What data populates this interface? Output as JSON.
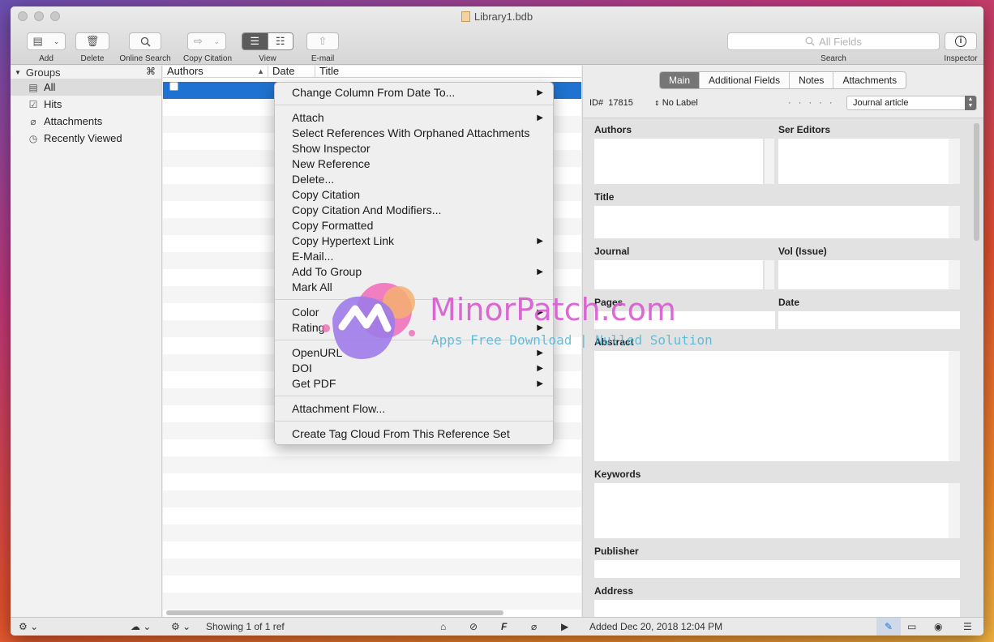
{
  "window": {
    "title": "Library1.bdb"
  },
  "toolbar": {
    "add_label": "Add",
    "delete_label": "Delete",
    "online_search_label": "Online Search",
    "copy_citation_label": "Copy Citation",
    "view_label": "View",
    "email_label": "E-mail",
    "search_placeholder": "All Fields",
    "search_label": "Search",
    "inspector_label": "Inspector"
  },
  "sidebar": {
    "header": "Groups",
    "header_shortcut": "⌘",
    "items": [
      {
        "label": "All",
        "icon": "library-icon",
        "selected": true
      },
      {
        "label": "Hits",
        "icon": "checkbox-icon"
      },
      {
        "label": "Attachments",
        "icon": "paperclip-icon"
      },
      {
        "label": "Recently Viewed",
        "icon": "clock-icon"
      }
    ]
  },
  "table": {
    "columns": [
      "Authors",
      "Date",
      "Title"
    ]
  },
  "status": {
    "showing": "Showing 1 of 1 ref",
    "added": "Added Dec 20, 2018 12:04 PM"
  },
  "context_menu": {
    "items": [
      "Change Column From Date To...",
      "Attach",
      "Select References With Orphaned Attachments",
      "Show Inspector",
      "New Reference",
      "Delete...",
      "Copy Citation",
      "Copy Citation And Modifiers...",
      "Copy Formatted",
      "Copy Hypertext Link",
      "E-Mail...",
      "Add To Group",
      "Mark All",
      "Color",
      "Rating",
      "OpenURL",
      "DOI",
      "Get PDF",
      "Attachment Flow...",
      "Create Tag Cloud From This Reference Set"
    ]
  },
  "detail": {
    "tabs": [
      "Main",
      "Additional Fields",
      "Notes",
      "Attachments"
    ],
    "id_prefix": "ID#",
    "id": "17815",
    "label": "No Label",
    "dots": "· · · · ·",
    "type": "Journal article",
    "fields": {
      "authors": "Authors",
      "ser_editors": "Ser Editors",
      "title": "Title",
      "journal": "Journal",
      "vol_issue": "Vol (Issue)",
      "pages": "Pages",
      "date": "Date",
      "abstract": "Abstract",
      "keywords": "Keywords",
      "publisher": "Publisher",
      "address": "Address"
    }
  },
  "watermark": {
    "title": "MinorPatch.com",
    "subtitle": "Apps Free Download | Nulled Solution"
  },
  "colors": {
    "selection": "#1f72cf",
    "accent_tab": "#767676"
  }
}
